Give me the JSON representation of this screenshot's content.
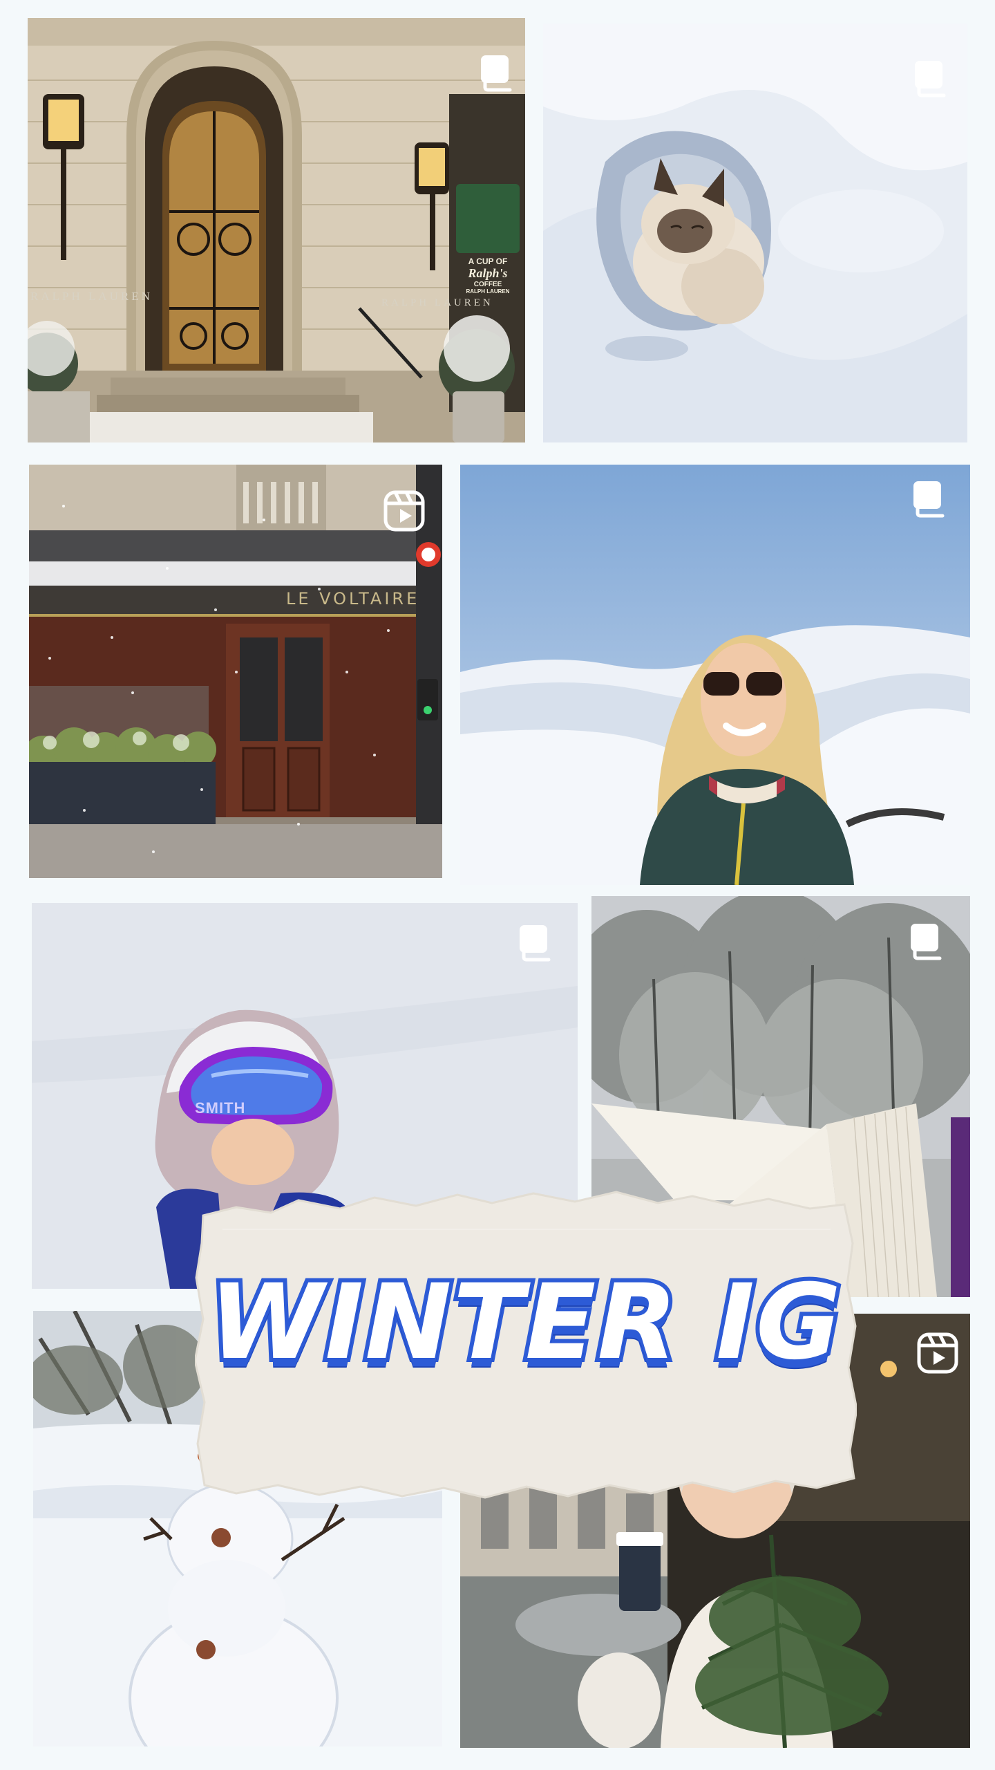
{
  "collage": {
    "title": "WINTER IG",
    "accent_blue": "#2d5bd6",
    "background": "#f4f9fb"
  },
  "tiles": [
    {
      "id": "ralph-lauren-storefront",
      "badge": "multi-image-icon",
      "texts": {
        "left_sign": "RALPH LAUREN",
        "right_sign": "RALPH LAUREN",
        "cup_line1": "A CUP OF",
        "cup_script": "Ralph's",
        "cup_line2": "COFFEE",
        "cup_line3": "RALPH LAUREN"
      }
    },
    {
      "id": "siamese-cat-in-snow",
      "badge": "multi-image-icon"
    },
    {
      "id": "le-voltaire-cafe",
      "badge": "reel-icon",
      "texts": {
        "sign": "LE VOLTAIRE"
      }
    },
    {
      "id": "woman-sunglasses-snow-mountains",
      "badge": "multi-image-icon"
    },
    {
      "id": "child-ski-goggles",
      "badge": "multi-image-icon",
      "texts": {
        "goggle_brand": "SMITH"
      }
    },
    {
      "id": "frosted-trees-book",
      "badge": "multi-image-icon"
    },
    {
      "id": "snowman",
      "badge": null
    },
    {
      "id": "girl-with-fir-branch-coffee",
      "badge": "reel-icon"
    }
  ]
}
